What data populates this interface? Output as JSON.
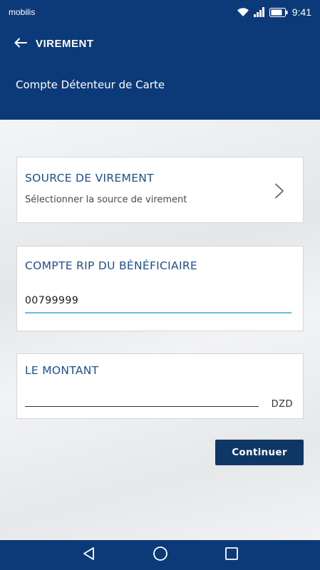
{
  "status_bar": {
    "carrier": "mobilis",
    "time": "9:41"
  },
  "header": {
    "title": "VIREMENT",
    "subtitle": "Compte Détenteur de Carte"
  },
  "source_card": {
    "title": "SOURCE DE VIREMENT",
    "description": "Sélectionner la source de virement"
  },
  "rip_card": {
    "title": "COMPTE RIP DU BÉNÉFICIAIRE",
    "value": "00799999"
  },
  "amount_card": {
    "title": "LE MONTANT",
    "value": "",
    "currency": "DZD"
  },
  "actions": {
    "continue_label": "Continuer"
  },
  "icons": {
    "back": "arrow-left-icon",
    "chevron": "chevron-right-icon",
    "nav_back": "triangle-back-icon",
    "nav_home": "circle-home-icon",
    "nav_recent": "square-recent-icon"
  },
  "colors": {
    "header_bg": "#0c3a78",
    "title_blue": "#1f4f8c",
    "active_underline": "#6cb7e0",
    "button_bg": "#0f3766"
  }
}
